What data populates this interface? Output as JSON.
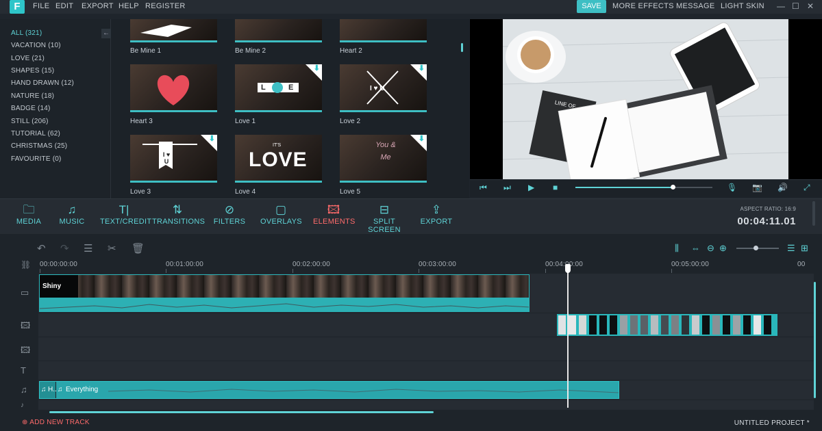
{
  "app": {
    "logo": "F"
  },
  "menu": {
    "items": [
      "FILE",
      "EDIT",
      "EXPORT",
      "HELP",
      "REGISTER"
    ]
  },
  "header": {
    "save": "SAVE",
    "more_effects": "MORE EFFECTS",
    "message": "MESSAGE",
    "light_skin": "LIGHT SKIN"
  },
  "window_controls": {
    "minimize": "—",
    "maximize": "☐",
    "close": "✕"
  },
  "library": {
    "categories": [
      "ALL (321)",
      "VACATION (10)",
      "LOVE (21)",
      "SHAPES (15)",
      "HAND DRAWN (12)",
      "NATURE (18)",
      "BADGE (14)",
      "STILL (206)",
      "TUTORIAL (62)",
      "CHRISTMAS (25)",
      "FAVOURITE (0)"
    ],
    "active_category": "ALL (321)",
    "collapse_icon": "←",
    "items": [
      "Be Mine 1",
      "Be Mine 2",
      "Heart 2",
      "Heart 3",
      "Love 1",
      "Love 2",
      "Love 3",
      "Love 4",
      "Love 5"
    ],
    "overlay_text": {
      "love1_l": "L",
      "love1_v": "E",
      "love2": "I ♥ U",
      "love3": "I ♥ U",
      "love4_small": "IT'S",
      "love4": "LOVE",
      "love5": "You & Me"
    }
  },
  "preview": {
    "notebook_text": "LINE OF",
    "progress": 0.71
  },
  "toolbar": {
    "media": "MEDIA",
    "music": "MUSIC",
    "text_credit": "TEXT/CREDIT",
    "transitions": "TRANSITIONS",
    "filters": "FILTERS",
    "overlays": "OVERLAYS",
    "elements": "ELEMENTS",
    "split_screen": "SPLIT SCREEN",
    "export": "EXPORT",
    "active": "ELEMENTS"
  },
  "status": {
    "aspect_ratio": "ASPECT RATIO: 16:9",
    "duration": "00:04:11.01"
  },
  "timeline": {
    "ruler": [
      "00:00:00:00",
      "00:01:00:00",
      "00:02:00:00",
      "00:03:00:00",
      "00:04:00:00",
      "00:05:00:00",
      "00"
    ],
    "video_clip": "Shiny",
    "audio_clip_short": "H..",
    "audio_clip": "Everything",
    "zoom_level": 0.45
  },
  "footer": {
    "add_track": "ADD NEW TRACK",
    "project": "UNTITLED PROJECT *"
  },
  "colors": {
    "accent": "#3ebfc4",
    "active": "#ff6b6b",
    "background": "#1f252c"
  }
}
